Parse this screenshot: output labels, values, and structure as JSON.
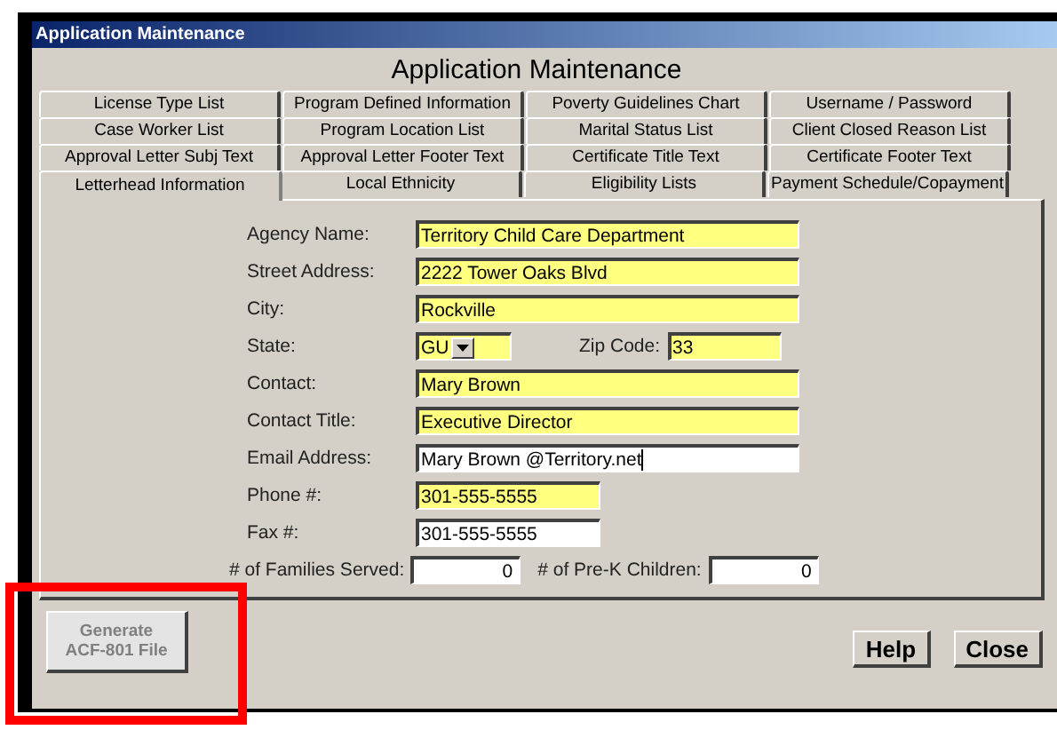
{
  "window": {
    "title": "Application Maintenance"
  },
  "heading": "Application Maintenance",
  "tab_rows": [
    [
      {
        "label": "License Type List",
        "selected": false
      },
      {
        "label": "Program Defined Information",
        "selected": false
      },
      {
        "label": "Poverty Guidelines Chart",
        "selected": false
      },
      {
        "label": "Username / Password",
        "selected": false
      }
    ],
    [
      {
        "label": "Case Worker List",
        "selected": false
      },
      {
        "label": "Program Location List",
        "selected": false
      },
      {
        "label": "Marital Status List",
        "selected": false
      },
      {
        "label": "Client Closed Reason List",
        "selected": false
      }
    ],
    [
      {
        "label": "Approval Letter Subj Text",
        "selected": false
      },
      {
        "label": "Approval Letter Footer Text",
        "selected": false
      },
      {
        "label": "Certificate Title Text",
        "selected": false
      },
      {
        "label": "Certificate Footer Text",
        "selected": false
      }
    ],
    [
      {
        "label": "Letterhead Information",
        "selected": true
      },
      {
        "label": "Local Ethnicity",
        "selected": false
      },
      {
        "label": "Eligibility Lists",
        "selected": false
      },
      {
        "label": "Payment Schedule/Copayment",
        "selected": false
      }
    ]
  ],
  "form_rows": [
    [
      {
        "label": "Agency Name:",
        "value": "Territory Child Care Department",
        "kind": "wide",
        "highlighted": true,
        "focused": false
      }
    ],
    [
      {
        "label": "Street Address:",
        "value": "2222 Tower Oaks Blvd",
        "kind": "wide",
        "highlighted": true,
        "focused": false
      }
    ],
    [
      {
        "label": "City:",
        "value": "Rockville",
        "kind": "wide",
        "highlighted": true,
        "focused": false
      }
    ],
    [
      {
        "label": "State:",
        "value": "GU",
        "kind": "combo",
        "highlighted": true,
        "focused": false
      },
      {
        "label": "Zip Code:",
        "value": "33",
        "kind": "short",
        "highlighted": true,
        "focused": false
      }
    ],
    [
      {
        "label": "Contact:",
        "value": "Mary Brown",
        "kind": "wide",
        "highlighted": true,
        "focused": false
      }
    ],
    [
      {
        "label": "Contact Title:",
        "value": "Executive Director",
        "kind": "wide",
        "highlighted": true,
        "focused": false
      }
    ],
    [
      {
        "label": "Email Address:",
        "value": "Mary Brown @Territory.net",
        "kind": "wide",
        "highlighted": false,
        "focused": true
      }
    ],
    [
      {
        "label": "Phone #:",
        "value": "301-555-5555",
        "kind": "medium",
        "highlighted": true,
        "focused": false
      }
    ],
    [
      {
        "label": "Fax #:",
        "value": "301-555-5555",
        "kind": "medium",
        "highlighted": false,
        "focused": false
      }
    ],
    [
      {
        "label": "# of Families Served:",
        "value": "0",
        "kind": "number",
        "highlighted": false,
        "focused": false
      },
      {
        "label": "# of Pre-K Children:",
        "value": "0",
        "kind": "number",
        "highlighted": false,
        "focused": false
      }
    ]
  ],
  "generate_button": {
    "label": "Generate\nACF-801 File",
    "disabled": true
  },
  "buttons": [
    "Help",
    "Close"
  ]
}
